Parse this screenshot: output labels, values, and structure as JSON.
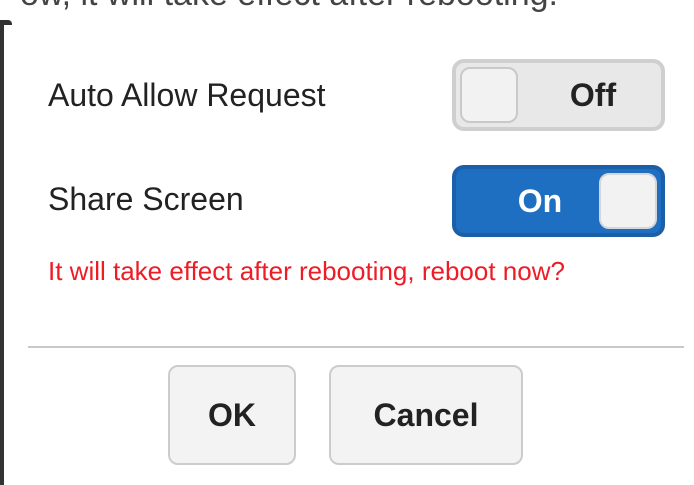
{
  "top_fragment": "ow, it will take effect after rebooting.",
  "settings": {
    "auto_allow": {
      "label": "Auto Allow Request",
      "state_text": "Off",
      "on": false
    },
    "share_screen": {
      "label": "Share Screen",
      "state_text": "On",
      "on": true
    }
  },
  "warning_text": "It will take effect after rebooting, reboot now?",
  "buttons": {
    "ok": "OK",
    "cancel": "Cancel"
  },
  "colors": {
    "toggle_on": "#1e6fc2",
    "toggle_off": "#e8e8e8",
    "warning": "#ee1c25"
  }
}
